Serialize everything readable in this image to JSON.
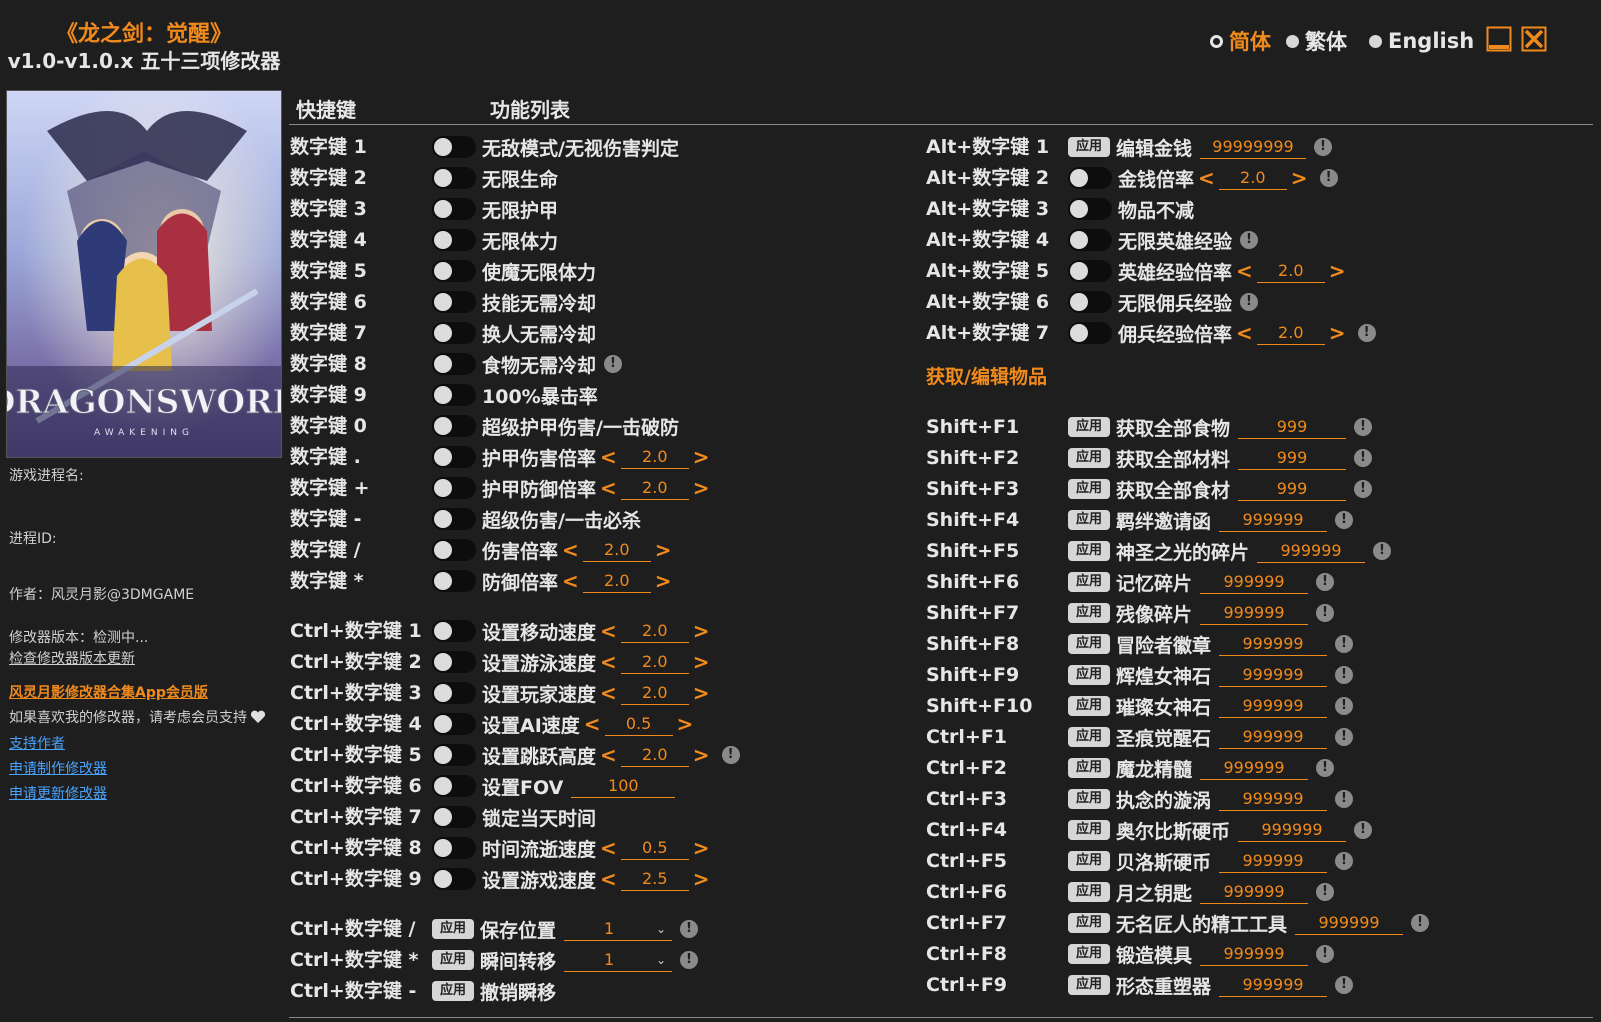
{
  "header": {
    "title": "《龙之剑：觉醒》",
    "subtitle": "v1.0-v1.0.x 五十三项修改器"
  },
  "languages": [
    "简体",
    "繁体",
    "English"
  ],
  "window": {
    "minimize_icon": "minimize-icon",
    "close_icon": "close-icon"
  },
  "cover": {
    "logo": "DRAGONSWORD",
    "tagline": "AWAKENING"
  },
  "sidebar": {
    "process_name_label": "游戏进程名:",
    "process_id_label": "进程ID:",
    "author": "作者：风灵月影@3DMGAME",
    "version": "修改器版本：检测中...",
    "check_update": "检查修改器版本更新",
    "app_link": "风灵月影修改器合集App会员版",
    "support_text": "如果喜欢我的修改器，请考虑会员支持",
    "links": [
      "支持作者",
      "申请制作修改器",
      "申请更新修改器"
    ]
  },
  "columns": {
    "hotkey": "快捷键",
    "features": "功能列表"
  },
  "section_title": "获取/编辑物品",
  "left_rows": [
    {
      "key": "数字键 1",
      "type": "toggle",
      "name": "无敌模式/无视伤害判定"
    },
    {
      "key": "数字键 2",
      "type": "toggle",
      "name": "无限生命"
    },
    {
      "key": "数字键 3",
      "type": "toggle",
      "name": "无限护甲"
    },
    {
      "key": "数字键 4",
      "type": "toggle",
      "name": "无限体力"
    },
    {
      "key": "数字键 5",
      "type": "toggle",
      "name": "使魔无限体力"
    },
    {
      "key": "数字键 6",
      "type": "toggle",
      "name": "技能无需冷却"
    },
    {
      "key": "数字键 7",
      "type": "toggle",
      "name": "换人无需冷却"
    },
    {
      "key": "数字键 8",
      "type": "toggle",
      "name": "食物无需冷却",
      "info": true
    },
    {
      "key": "数字键 9",
      "type": "toggle",
      "name": "100%暴击率"
    },
    {
      "key": "数字键 0",
      "type": "toggle",
      "name": "超级护甲伤害/一击破防"
    },
    {
      "key": "数字键 .",
      "type": "toggle",
      "name": "护甲伤害倍率",
      "value": "2.0",
      "arrows": true
    },
    {
      "key": "数字键 +",
      "type": "toggle",
      "name": "护甲防御倍率",
      "value": "2.0",
      "arrows": true
    },
    {
      "key": "数字键 -",
      "type": "toggle",
      "name": "超级伤害/一击必杀"
    },
    {
      "key": "数字键 /",
      "type": "toggle",
      "name": "伤害倍率",
      "value": "2.0",
      "arrows": true
    },
    {
      "key": "数字键 *",
      "type": "toggle",
      "name": "防御倍率",
      "value": "2.0",
      "arrows": true
    },
    {
      "key": "Ctrl+数字键 1",
      "type": "toggle",
      "name": "设置移动速度",
      "value": "2.0",
      "arrows": true
    },
    {
      "key": "Ctrl+数字键 2",
      "type": "toggle",
      "name": "设置游泳速度",
      "value": "2.0",
      "arrows": true
    },
    {
      "key": "Ctrl+数字键 3",
      "type": "toggle",
      "name": "设置玩家速度",
      "value": "2.0",
      "arrows": true
    },
    {
      "key": "Ctrl+数字键 4",
      "type": "toggle",
      "name": "设置AI速度",
      "value": "0.5",
      "arrows": true
    },
    {
      "key": "Ctrl+数字键 5",
      "type": "toggle",
      "name": "设置跳跃高度",
      "value": "2.0",
      "arrows": true,
      "info": true
    },
    {
      "key": "Ctrl+数字键 6",
      "type": "toggle",
      "name": "设置FOV",
      "value": "100"
    },
    {
      "key": "Ctrl+数字键 7",
      "type": "toggle",
      "name": "锁定当天时间"
    },
    {
      "key": "Ctrl+数字键 8",
      "type": "toggle",
      "name": "时间流逝速度",
      "value": "0.5",
      "arrows": true
    },
    {
      "key": "Ctrl+数字键 9",
      "type": "toggle",
      "name": "设置游戏速度",
      "value": "2.5",
      "arrows": true
    },
    {
      "key": "Ctrl+数字键 /",
      "type": "apply",
      "name": "保存位置",
      "select": "1",
      "info": true
    },
    {
      "key": "Ctrl+数字键 *",
      "type": "apply",
      "name": "瞬间转移",
      "select": "1",
      "info": true
    },
    {
      "key": "Ctrl+数字键 -",
      "type": "apply",
      "name": "撤销瞬移"
    }
  ],
  "right_top_rows": [
    {
      "key": "Alt+数字键 1",
      "type": "apply",
      "name": "编辑金钱",
      "value": "99999999",
      "info": true
    },
    {
      "key": "Alt+数字键 2",
      "type": "toggle",
      "name": "金钱倍率",
      "value": "2.0",
      "arrows": true,
      "info": true
    },
    {
      "key": "Alt+数字键 3",
      "type": "toggle",
      "name": "物品不减"
    },
    {
      "key": "Alt+数字键 4",
      "type": "toggle",
      "name": "无限英雄经验",
      "info": true
    },
    {
      "key": "Alt+数字键 5",
      "type": "toggle",
      "name": "英雄经验倍率",
      "value": "2.0",
      "arrows": true
    },
    {
      "key": "Alt+数字键 6",
      "type": "toggle",
      "name": "无限佣兵经验",
      "info": true
    },
    {
      "key": "Alt+数字键 7",
      "type": "toggle",
      "name": "佣兵经验倍率",
      "value": "2.0",
      "arrows": true,
      "info": true
    }
  ],
  "right_bottom_rows": [
    {
      "key": "Shift+F1",
      "type": "apply",
      "name": "获取全部食物",
      "value": "999",
      "info": true
    },
    {
      "key": "Shift+F2",
      "type": "apply",
      "name": "获取全部材料",
      "value": "999",
      "info": true
    },
    {
      "key": "Shift+F3",
      "type": "apply",
      "name": "获取全部食材",
      "value": "999",
      "info": true
    },
    {
      "key": "Shift+F4",
      "type": "apply",
      "name": "羁绊邀请函",
      "value": "999999",
      "info": true
    },
    {
      "key": "Shift+F5",
      "type": "apply",
      "name": "神圣之光的碎片",
      "value": "999999",
      "info": true
    },
    {
      "key": "Shift+F6",
      "type": "apply",
      "name": "记忆碎片",
      "value": "999999",
      "info": true
    },
    {
      "key": "Shift+F7",
      "type": "apply",
      "name": "残像碎片",
      "value": "999999",
      "info": true
    },
    {
      "key": "Shift+F8",
      "type": "apply",
      "name": "冒险者徽章",
      "value": "999999",
      "info": true
    },
    {
      "key": "Shift+F9",
      "type": "apply",
      "name": "辉煌女神石",
      "value": "999999",
      "info": true
    },
    {
      "key": "Shift+F10",
      "type": "apply",
      "name": "璀璨女神石",
      "value": "999999",
      "info": true
    },
    {
      "key": "Ctrl+F1",
      "type": "apply",
      "name": "圣痕觉醒石",
      "value": "999999",
      "info": true
    },
    {
      "key": "Ctrl+F2",
      "type": "apply",
      "name": "魔龙精髓",
      "value": "999999",
      "info": true
    },
    {
      "key": "Ctrl+F3",
      "type": "apply",
      "name": "执念的漩涡",
      "value": "999999",
      "info": true
    },
    {
      "key": "Ctrl+F4",
      "type": "apply",
      "name": "奥尔比斯硬币",
      "value": "999999",
      "info": true
    },
    {
      "key": "Ctrl+F5",
      "type": "apply",
      "name": "贝洛斯硬币",
      "value": "999999",
      "info": true
    },
    {
      "key": "Ctrl+F6",
      "type": "apply",
      "name": "月之钥匙",
      "value": "999999",
      "info": true
    },
    {
      "key": "Ctrl+F7",
      "type": "apply",
      "name": "无名匠人的精工工具",
      "value": "999999",
      "info": true
    },
    {
      "key": "Ctrl+F8",
      "type": "apply",
      "name": "锻造模具",
      "value": "999999",
      "info": true
    },
    {
      "key": "Ctrl+F9",
      "type": "apply",
      "name": "形态重塑器",
      "value": "999999",
      "info": true
    }
  ],
  "apply_label": "应用",
  "info_glyph": "!",
  "colors": {
    "accent": "#f08a1c",
    "background": "#1e1e1e",
    "link": "#4aa3ff"
  }
}
